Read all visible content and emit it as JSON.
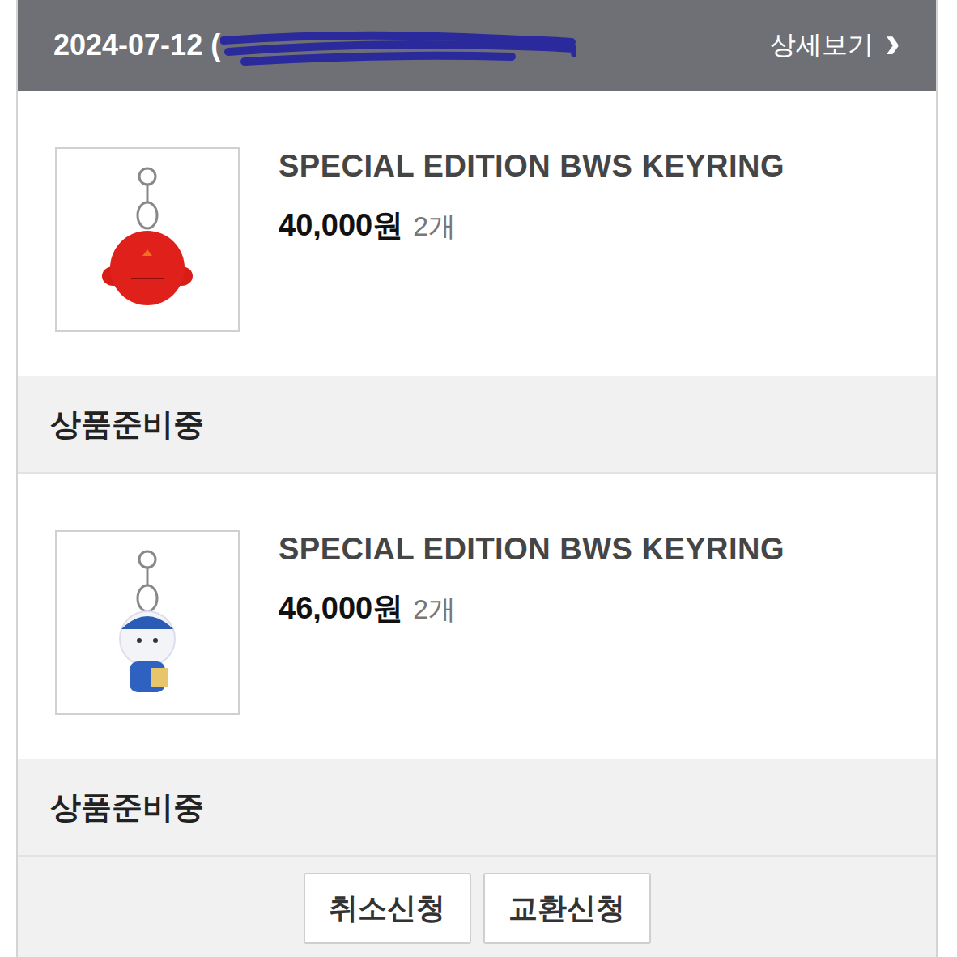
{
  "header": {
    "date": "2024-07-12 (",
    "detail_link": "상세보기",
    "detail_arrow": "›"
  },
  "orders": [
    {
      "title": "SPECIAL EDITION BWS KEYRING",
      "price": "40,000원",
      "quantity": "2개",
      "status": "상품준비중",
      "kind": "bird"
    },
    {
      "title": "SPECIAL EDITION BWS KEYRING",
      "price": "46,000원",
      "quantity": "2개",
      "status": "상품준비중",
      "kind": "bear"
    }
  ],
  "buttons": [
    {
      "label": "취소신청"
    },
    {
      "label": "교환신청"
    }
  ]
}
